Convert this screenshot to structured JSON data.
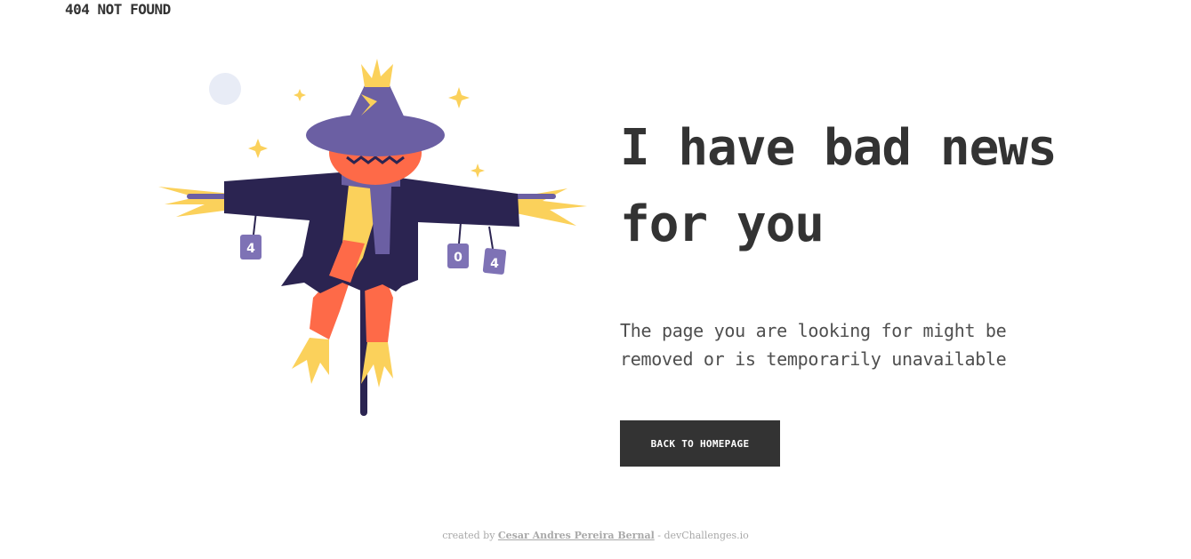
{
  "header": {
    "brand": "404 NOT FOUND"
  },
  "illustration": {
    "can_labels": [
      "4",
      "0",
      "4"
    ]
  },
  "main": {
    "headline": "I have bad news for you",
    "description": "The page you are looking for might be removed or is temporarily unavailable",
    "button_label": "BACK TO HOMEPAGE"
  },
  "footer": {
    "prefix": "created by",
    "author": "Cesar Andres Pereira Bernal",
    "separator": " - ",
    "site": "devChallenges.io"
  },
  "colors": {
    "text": "#333333",
    "button_bg": "#333333",
    "button_text": "#ffffff",
    "coat": "#2b2451",
    "hat": "#6b5fa3",
    "face": "#fe6a48",
    "straw": "#fbd15b",
    "moon": "#e8ecf6"
  }
}
